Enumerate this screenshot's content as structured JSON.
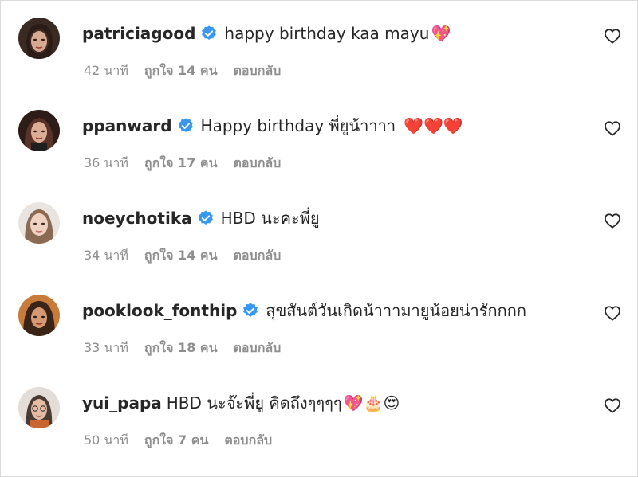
{
  "comments": [
    {
      "username": "patriciagood",
      "verified": true,
      "text": "happy birthday kaa mayu",
      "emoji": "💖",
      "time": "42 นาที",
      "likes": "ถูกใจ 14 คน",
      "reply": "ตอบกลับ"
    },
    {
      "username": "ppanward",
      "verified": true,
      "text": "Happy birthday พี่ยูน้าาาา",
      "emoji": "❤️❤️❤️",
      "time": "36 นาที",
      "likes": "ถูกใจ 17 คน",
      "reply": "ตอบกลับ"
    },
    {
      "username": "noeychotika",
      "verified": true,
      "text": "HBD นะคะพี่ยู",
      "emoji": "",
      "time": "34 นาที",
      "likes": "ถูกใจ 14 คน",
      "reply": "ตอบกลับ"
    },
    {
      "username": "pooklook_fonthip",
      "verified": true,
      "text": "สุขสันต์วันเกิดน้าาามายูน้อยน่ารักกกก",
      "emoji": "",
      "time": "33 นาที",
      "likes": "ถูกใจ 18 คน",
      "reply": "ตอบกลับ"
    },
    {
      "username": "yui_papa",
      "verified": false,
      "text": "HBD นะจ๊ะพี่ยู คิดถึงๆๆๆๆ",
      "emoji": "💖🎂😍",
      "time": "50 นาที",
      "likes": "ถูกใจ 7 คน",
      "reply": "ตอบกลับ"
    }
  ],
  "colors": {
    "text": "#262626",
    "meta": "#8e8e8e",
    "verified": "#3897f0",
    "heart_emoji": "#e8102d"
  },
  "icons": {
    "verified": "verified-badge-icon",
    "like": "heart-outline-icon"
  }
}
